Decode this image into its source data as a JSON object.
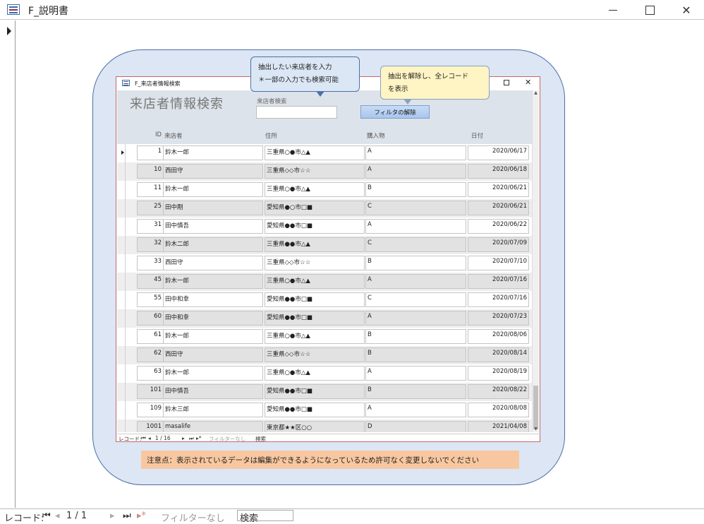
{
  "window": {
    "title": "F_説明書"
  },
  "inner_form": {
    "window_title": "F_来店者情報検索",
    "form_title": "来店者情報検索",
    "search_label": "来店者検索",
    "search_value": "",
    "filter_button": "フィルタの解除",
    "columns": {
      "id": "ID",
      "name": "来店者",
      "address": "住所",
      "purchase": "購入物",
      "date": "日付"
    },
    "rows": [
      {
        "id": "1",
        "name": "鈴木一郎",
        "address": "三重県○●市△▲",
        "purchase": "A",
        "date": "2020/06/17"
      },
      {
        "id": "10",
        "name": "西田守",
        "address": "三重県◇◇市☆☆",
        "purchase": "A",
        "date": "2020/06/18"
      },
      {
        "id": "11",
        "name": "鈴木一郎",
        "address": "三重県○●市△▲",
        "purchase": "B",
        "date": "2020/06/21"
      },
      {
        "id": "25",
        "name": "田中剛",
        "address": "愛知県●○市□■",
        "purchase": "C",
        "date": "2020/06/21"
      },
      {
        "id": "31",
        "name": "田中慎吾",
        "address": "愛知県●●市□■",
        "purchase": "A",
        "date": "2020/06/22"
      },
      {
        "id": "32",
        "name": "鈴木二郎",
        "address": "三重県●●市△▲",
        "purchase": "C",
        "date": "2020/07/09"
      },
      {
        "id": "33",
        "name": "西田守",
        "address": "三重県◇◇市☆☆",
        "purchase": "B",
        "date": "2020/07/10"
      },
      {
        "id": "45",
        "name": "鈴木一郎",
        "address": "三重県○●市△▲",
        "purchase": "A",
        "date": "2020/07/16"
      },
      {
        "id": "55",
        "name": "田中和幸",
        "address": "愛知県●●市□■",
        "purchase": "C",
        "date": "2020/07/16"
      },
      {
        "id": "60",
        "name": "田中和幸",
        "address": "愛知県●●市□■",
        "purchase": "A",
        "date": "2020/07/23"
      },
      {
        "id": "61",
        "name": "鈴木一郎",
        "address": "三重県○●市△▲",
        "purchase": "B",
        "date": "2020/08/06"
      },
      {
        "id": "62",
        "name": "西田守",
        "address": "三重県◇◇市☆☆",
        "purchase": "B",
        "date": "2020/08/14"
      },
      {
        "id": "63",
        "name": "鈴木一郎",
        "address": "三重県○●市△▲",
        "purchase": "A",
        "date": "2020/08/19"
      },
      {
        "id": "101",
        "name": "田中慎吾",
        "address": "愛知県●●市□■",
        "purchase": "B",
        "date": "2020/08/22"
      },
      {
        "id": "109",
        "name": "鈴木三郎",
        "address": "愛知県●●市□■",
        "purchase": "A",
        "date": "2020/08/08"
      },
      {
        "id": "1001",
        "name": "masalife",
        "address": "東京都★★区○○",
        "purchase": "D",
        "date": "2021/04/08"
      }
    ],
    "nav": {
      "record_label": "レコード:",
      "position": "1 / 16",
      "filter": "フィルターなし",
      "search": "検索"
    }
  },
  "callouts": {
    "search": [
      "抽出したい来店者を入力",
      "＊一部の入力でも検索可能"
    ],
    "filter": [
      "抽出を解除し、全レコード",
      "を表示"
    ]
  },
  "notice": "注意点：表示されているデータは編集ができるようになっているため許可なく変更しないでください",
  "outer_nav": {
    "record_label": "レコード:",
    "position": "1 / 1",
    "filter": "フィルターなし",
    "search": "検索"
  }
}
